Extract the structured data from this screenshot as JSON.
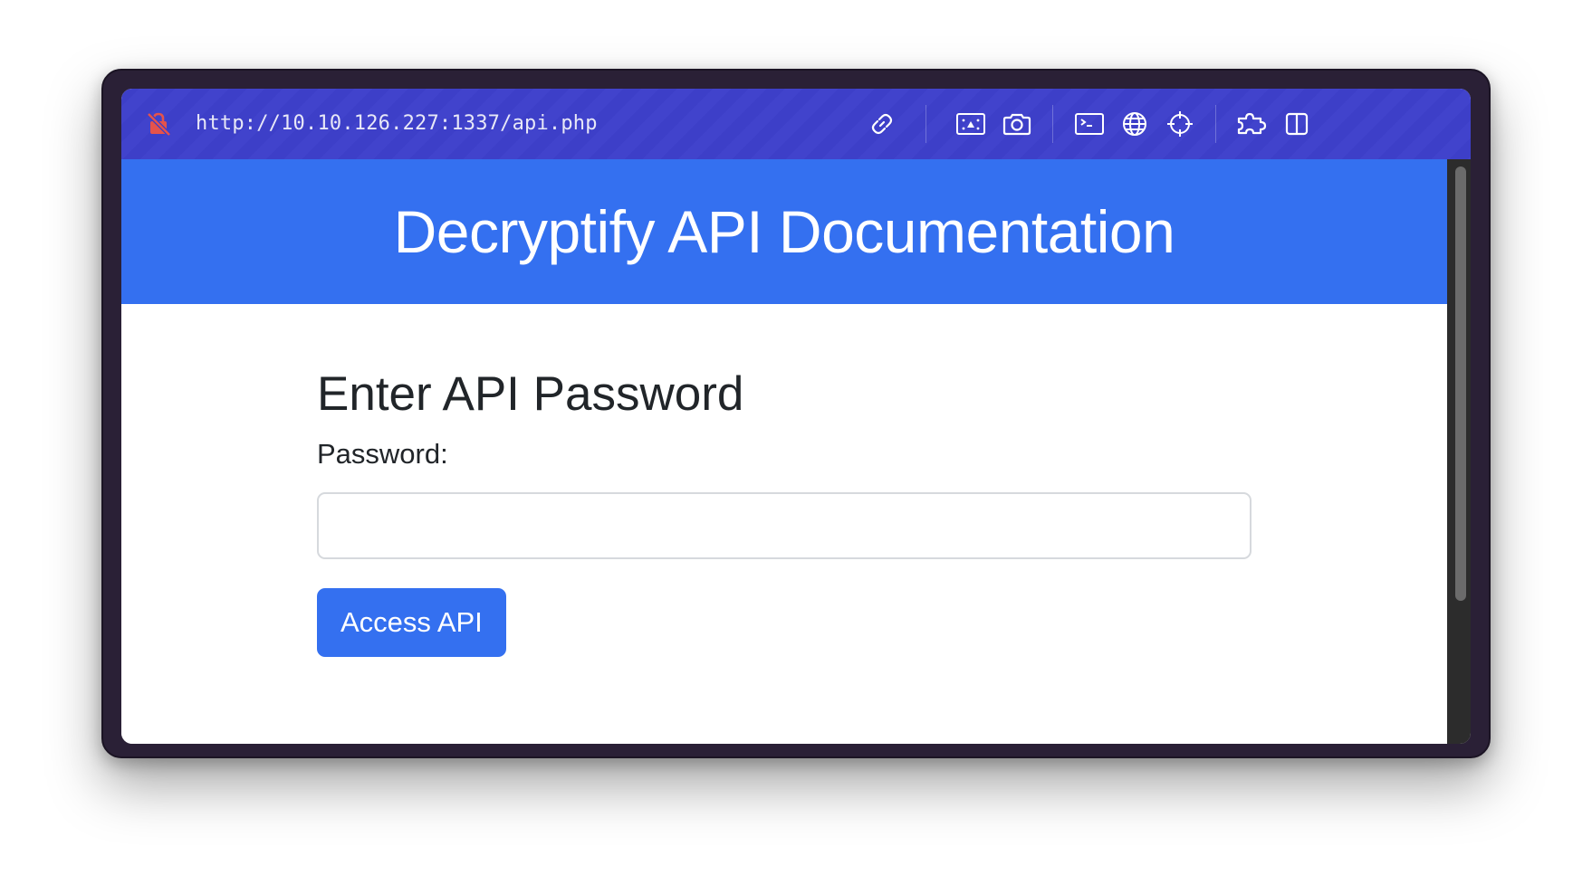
{
  "browser": {
    "url": "http://10.10.126.227:1337/api.php",
    "icons": [
      "lock-slash-icon",
      "link-icon",
      "image-icon",
      "camera-icon",
      "terminal-icon",
      "globe-icon",
      "crosshair-icon",
      "puzzle-icon",
      "split-view-icon"
    ]
  },
  "page": {
    "header_title": "Decryptify API Documentation",
    "form_title": "Enter API Password",
    "password_label": "Password:",
    "password_value": "",
    "password_placeholder": "",
    "submit_label": "Access API"
  },
  "colors": {
    "primary": "#3470f0",
    "toolbar": "#3d3fc8",
    "lock_icon": "#e5534b"
  }
}
